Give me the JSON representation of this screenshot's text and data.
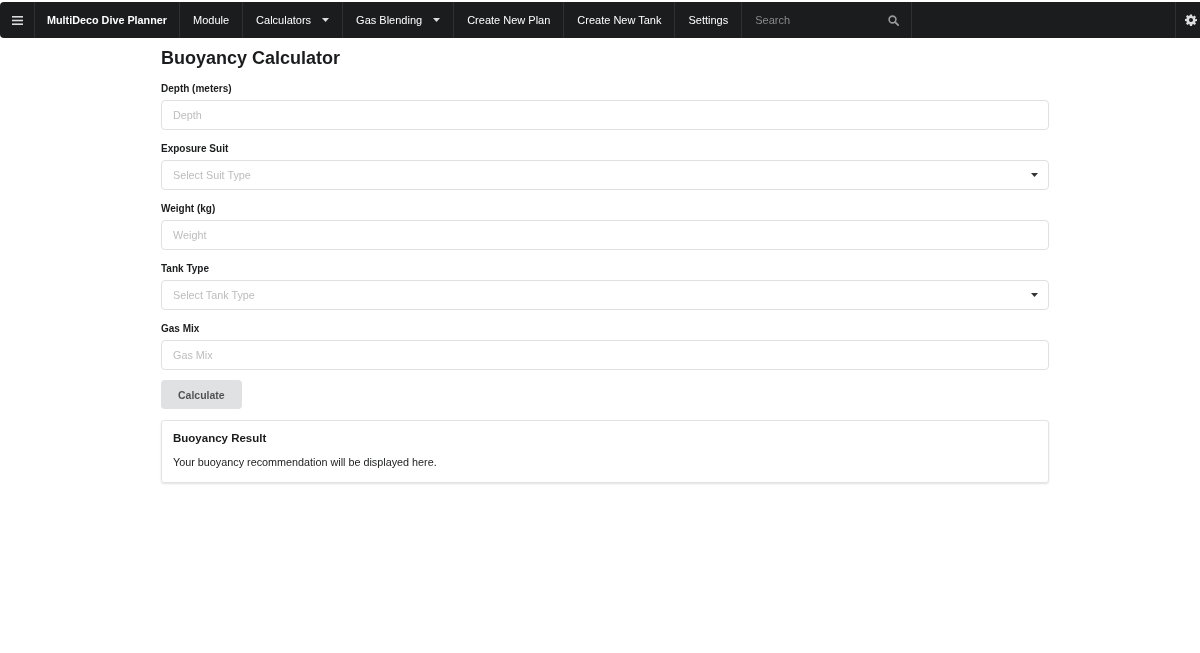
{
  "navbar": {
    "brand": "MultiDeco Dive Planner",
    "items": [
      {
        "kind": "link",
        "label": "Module"
      },
      {
        "kind": "dropdown",
        "label": "Calculators"
      },
      {
        "kind": "dropdown",
        "label": "Gas Blending"
      },
      {
        "kind": "link",
        "label": "Create New Plan"
      },
      {
        "kind": "link",
        "label": "Create New Tank"
      },
      {
        "kind": "link",
        "label": "Settings"
      }
    ],
    "search": {
      "placeholder": "Search"
    }
  },
  "page": {
    "title": "Buoyancy Calculator"
  },
  "form": {
    "fields": [
      {
        "kind": "input",
        "label": "Depth (meters)",
        "placeholder": "Depth"
      },
      {
        "kind": "select",
        "label": "Exposure Suit",
        "placeholder": "Select Suit Type"
      },
      {
        "kind": "input",
        "label": "Weight (kg)",
        "placeholder": "Weight"
      },
      {
        "kind": "select",
        "label": "Tank Type",
        "placeholder": "Select Tank Type"
      },
      {
        "kind": "input",
        "label": "Gas Mix",
        "placeholder": "Gas Mix"
      }
    ],
    "button": "Calculate"
  },
  "result": {
    "title": "Buoyancy Result",
    "text": "Your buoyancy recommendation will be displayed here."
  }
}
